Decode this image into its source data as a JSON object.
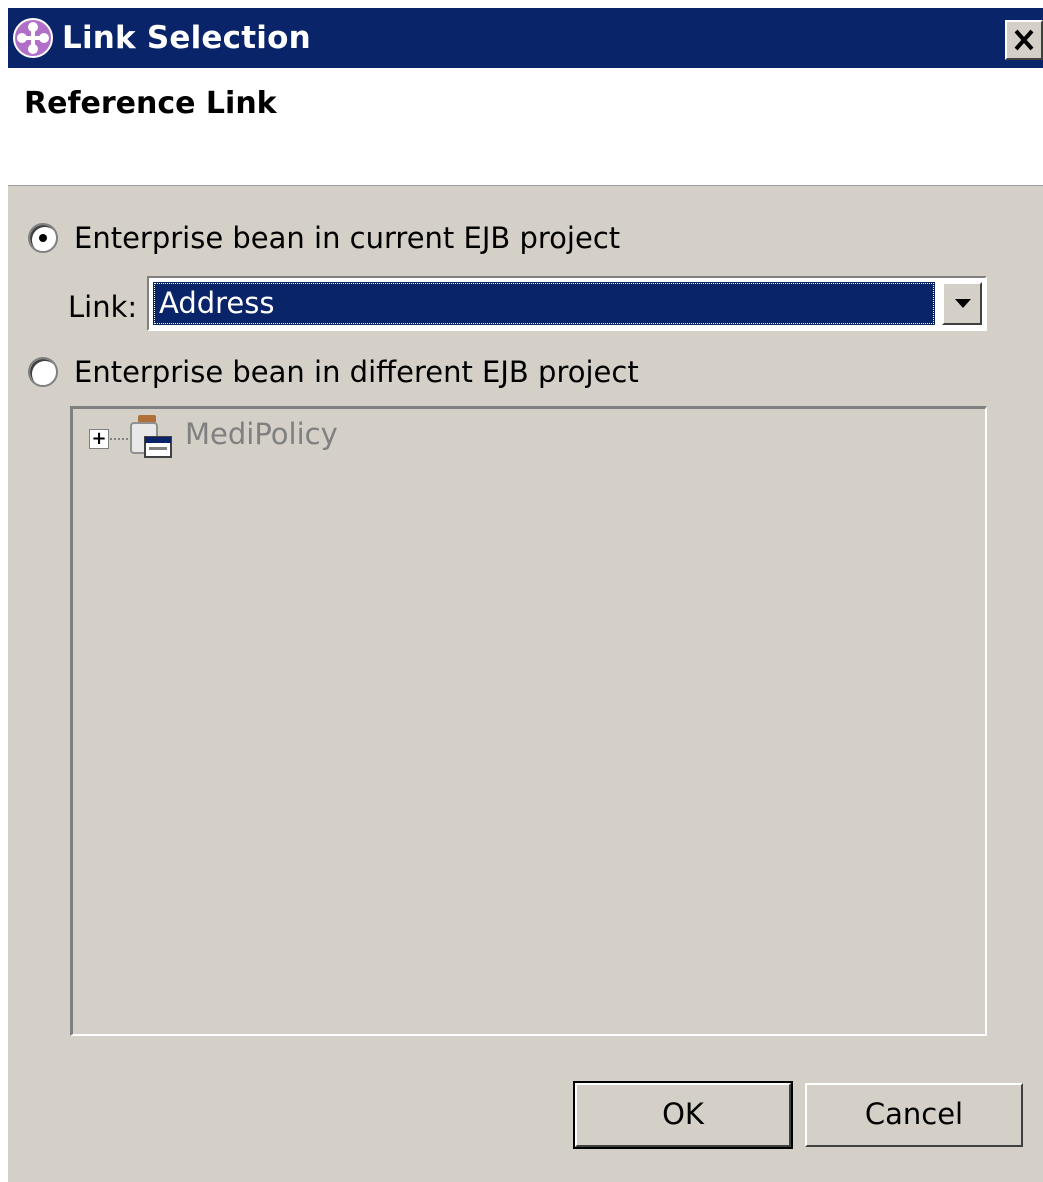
{
  "window": {
    "title": "Link Selection"
  },
  "header": {
    "title": "Reference Link"
  },
  "options": {
    "current_project": {
      "label": "Enterprise bean in current EJB project",
      "selected": true
    },
    "different_project": {
      "label": "Enterprise bean in different EJB project",
      "selected": false
    }
  },
  "link": {
    "label": "Link:",
    "value": "Address"
  },
  "tree": {
    "items": [
      {
        "label": "MediPolicy",
        "expander": "+",
        "icon": "ejb-project-icon"
      }
    ]
  },
  "buttons": {
    "ok": "OK",
    "cancel": "Cancel"
  },
  "colors": {
    "titlebar": "#0a246a",
    "face": "#d4d0c8",
    "selection": "#0a246a"
  }
}
